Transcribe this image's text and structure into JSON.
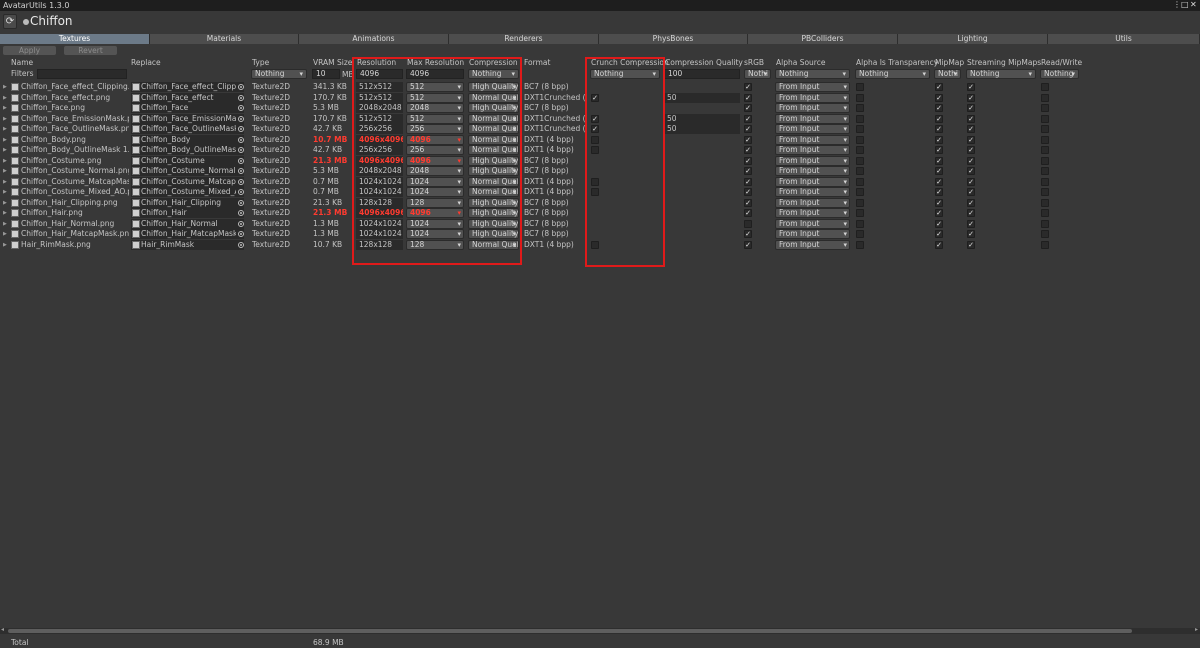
{
  "window": {
    "title": "AvatarUtils 1.3.0",
    "controls": [
      "⋮",
      "□",
      "✕"
    ]
  },
  "header": {
    "avatar_name": "Chiffon",
    "refresh_icon": "refresh-icon"
  },
  "tabs": [
    "Textures",
    "Materials",
    "Animations",
    "Renderers",
    "PhysBones",
    "PBColliders",
    "Lighting",
    "Utils"
  ],
  "active_tab": "Textures",
  "actions": {
    "apply": "Apply",
    "revert": "Revert"
  },
  "columns": {
    "name": "Name",
    "replace": "Replace",
    "type": "Type",
    "vram": "VRAM Size",
    "resolution": "Resolution",
    "max_resolution": "Max Resolution",
    "compression": "Compression",
    "format": "Format",
    "crunch": "Crunch Compression",
    "quality": "Compression Quality",
    "srgb": "sRGB",
    "alpha_source": "Alpha Source",
    "alpha_transparency": "Alpha Is Transparency",
    "mipmap": "MipMap",
    "streaming": "Streaming MipMaps",
    "readwrite": "Read/Write"
  },
  "filters": {
    "label": "Filters",
    "type": "Nothing",
    "vram_value": "10",
    "vram_unit": "MB",
    "resolution": "4096",
    "max_resolution": "4096",
    "compression": "Nothing",
    "crunch": "Nothing",
    "quality": "100",
    "srgb": "Nothi",
    "alpha_source": "Nothing",
    "alpha_transparency": "Nothing",
    "mipmap": "Nothi",
    "streaming": "Nothing",
    "readwrite": "Nothing"
  },
  "rows": [
    {
      "name": "Chiffon_Face_effect_Clipping.pn",
      "replace": "Chiffon_Face_effect_Clipping",
      "type": "Texture2D",
      "vram": "341.3 KB",
      "res": "512x512",
      "maxres": "512",
      "comp": "High Quality",
      "format": "BC7 (8 bpp)",
      "crunch": null,
      "quality": "",
      "srgb": true,
      "alpha": "From Input",
      "alpha_t": false,
      "mip": true,
      "stream": true,
      "rw": false,
      "warn": false
    },
    {
      "name": "Chiffon_Face_effect.png",
      "replace": "Chiffon_Face_effect",
      "type": "Texture2D",
      "vram": "170.7 KB",
      "res": "512x512",
      "maxres": "512",
      "comp": "Normal Qual",
      "format": "DXT1Crunched (4",
      "crunch": true,
      "quality": "50",
      "srgb": true,
      "alpha": "From Input",
      "alpha_t": false,
      "mip": true,
      "stream": true,
      "rw": false,
      "warn": false
    },
    {
      "name": "Chiffon_Face.png",
      "replace": "Chiffon_Face",
      "type": "Texture2D",
      "vram": "5.3 MB",
      "res": "2048x2048",
      "maxres": "2048",
      "comp": "High Quality",
      "format": "BC7 (8 bpp)",
      "crunch": null,
      "quality": "",
      "srgb": true,
      "alpha": "From Input",
      "alpha_t": false,
      "mip": true,
      "stream": true,
      "rw": false,
      "warn": false
    },
    {
      "name": "Chiffon_Face_EmissionMask.pn",
      "replace": "Chiffon_Face_EmissionMask",
      "type": "Texture2D",
      "vram": "170.7 KB",
      "res": "512x512",
      "maxres": "512",
      "comp": "Normal Qual",
      "format": "DXT1Crunched (4",
      "crunch": true,
      "quality": "50",
      "srgb": true,
      "alpha": "From Input",
      "alpha_t": false,
      "mip": true,
      "stream": true,
      "rw": false,
      "warn": false
    },
    {
      "name": "Chiffon_Face_OutlineMask.png",
      "replace": "Chiffon_Face_OutlineMask",
      "type": "Texture2D",
      "vram": "42.7 KB",
      "res": "256x256",
      "maxres": "256",
      "comp": "Normal Qual",
      "format": "DXT1Crunched (4",
      "crunch": true,
      "quality": "50",
      "srgb": true,
      "alpha": "From Input",
      "alpha_t": false,
      "mip": true,
      "stream": true,
      "rw": false,
      "warn": false
    },
    {
      "name": "Chiffon_Body.png",
      "replace": "Chiffon_Body",
      "type": "Texture2D",
      "vram": "10.7 MB",
      "res": "4096x4096",
      "maxres": "4096",
      "comp": "Normal Qual",
      "format": "DXT1 (4 bpp)",
      "crunch": false,
      "quality": "",
      "srgb": true,
      "alpha": "From Input",
      "alpha_t": false,
      "mip": true,
      "stream": true,
      "rw": false,
      "warn": true
    },
    {
      "name": "Chiffon_Body_OutlineMask 1.pn",
      "replace": "Chiffon_Body_OutlineMask 1",
      "type": "Texture2D",
      "vram": "42.7 KB",
      "res": "256x256",
      "maxres": "256",
      "comp": "Normal Qual",
      "format": "DXT1 (4 bpp)",
      "crunch": false,
      "quality": "",
      "srgb": true,
      "alpha": "From Input",
      "alpha_t": false,
      "mip": true,
      "stream": true,
      "rw": false,
      "warn": false
    },
    {
      "name": "Chiffon_Costume.png",
      "replace": "Chiffon_Costume",
      "type": "Texture2D",
      "vram": "21.3 MB",
      "res": "4096x4096",
      "maxres": "4096",
      "comp": "High Quality",
      "format": "BC7 (8 bpp)",
      "crunch": null,
      "quality": "",
      "srgb": true,
      "alpha": "From Input",
      "alpha_t": false,
      "mip": true,
      "stream": true,
      "rw": false,
      "warn": true
    },
    {
      "name": "Chiffon_Costume_Normal.png",
      "replace": "Chiffon_Costume_Normal",
      "type": "Texture2D",
      "vram": "5.3 MB",
      "res": "2048x2048",
      "maxres": "2048",
      "comp": "High Quality",
      "format": "BC7 (8 bpp)",
      "crunch": null,
      "quality": "",
      "srgb": true,
      "alpha": "From Input",
      "alpha_t": false,
      "mip": true,
      "stream": true,
      "rw": false,
      "warn": false
    },
    {
      "name": "Chiffon_Costume_MatcapMask.",
      "replace": "Chiffon_Costume_MatcapMa",
      "type": "Texture2D",
      "vram": "0.7 MB",
      "res": "1024x1024",
      "maxres": "1024",
      "comp": "Normal Qual",
      "format": "DXT1 (4 bpp)",
      "crunch": false,
      "quality": "",
      "srgb": true,
      "alpha": "From Input",
      "alpha_t": false,
      "mip": true,
      "stream": true,
      "rw": false,
      "warn": false
    },
    {
      "name": "Chiffon_Costume_Mixed_AO.png",
      "replace": "Chiffon_Costume_Mixed_AO",
      "type": "Texture2D",
      "vram": "0.7 MB",
      "res": "1024x1024",
      "maxres": "1024",
      "comp": "Normal Qual",
      "format": "DXT1 (4 bpp)",
      "crunch": false,
      "quality": "",
      "srgb": true,
      "alpha": "From Input",
      "alpha_t": false,
      "mip": true,
      "stream": true,
      "rw": false,
      "warn": false
    },
    {
      "name": "Chiffon_Hair_Clipping.png",
      "replace": "Chiffon_Hair_Clipping",
      "type": "Texture2D",
      "vram": "21.3 KB",
      "res": "128x128",
      "maxres": "128",
      "comp": "High Quality",
      "format": "BC7 (8 bpp)",
      "crunch": null,
      "quality": "",
      "srgb": true,
      "alpha": "From Input",
      "alpha_t": false,
      "mip": true,
      "stream": true,
      "rw": false,
      "warn": false
    },
    {
      "name": "Chiffon_Hair.png",
      "replace": "Chiffon_Hair",
      "type": "Texture2D",
      "vram": "21.3 MB",
      "res": "4096x4096",
      "maxres": "4096",
      "comp": "High Quality",
      "format": "BC7 (8 bpp)",
      "crunch": null,
      "quality": "",
      "srgb": true,
      "alpha": "From Input",
      "alpha_t": false,
      "mip": true,
      "stream": true,
      "rw": false,
      "warn": true
    },
    {
      "name": "Chiffon_Hair_Normal.png",
      "replace": "Chiffon_Hair_Normal",
      "type": "Texture2D",
      "vram": "1.3 MB",
      "res": "1024x1024",
      "maxres": "1024",
      "comp": "High Quality",
      "format": "BC7 (8 bpp)",
      "crunch": null,
      "quality": "",
      "srgb": false,
      "alpha": "From Input",
      "alpha_t": false,
      "mip": true,
      "stream": true,
      "rw": false,
      "warn": false
    },
    {
      "name": "Chiffon_Hair_MatcapMask.png",
      "replace": "Chiffon_Hair_MatcapMask",
      "type": "Texture2D",
      "vram": "1.3 MB",
      "res": "1024x1024",
      "maxres": "1024",
      "comp": "High Quality",
      "format": "BC7 (8 bpp)",
      "crunch": null,
      "quality": "",
      "srgb": true,
      "alpha": "From Input",
      "alpha_t": false,
      "mip": true,
      "stream": true,
      "rw": false,
      "warn": false
    },
    {
      "name": "Hair_RimMask.png",
      "replace": "Hair_RimMask",
      "type": "Texture2D",
      "vram": "10.7 KB",
      "res": "128x128",
      "maxres": "128",
      "comp": "Normal Qual",
      "format": "DXT1 (4 bpp)",
      "crunch": false,
      "quality": "",
      "srgb": true,
      "alpha": "From Input",
      "alpha_t": false,
      "mip": true,
      "stream": true,
      "rw": false,
      "warn": false
    }
  ],
  "footer": {
    "label": "Total",
    "value": "68.9 MB"
  },
  "colors": {
    "highlight": "#e01a1a",
    "warning": "#ff3b30",
    "active_tab": "#6c7a88"
  }
}
